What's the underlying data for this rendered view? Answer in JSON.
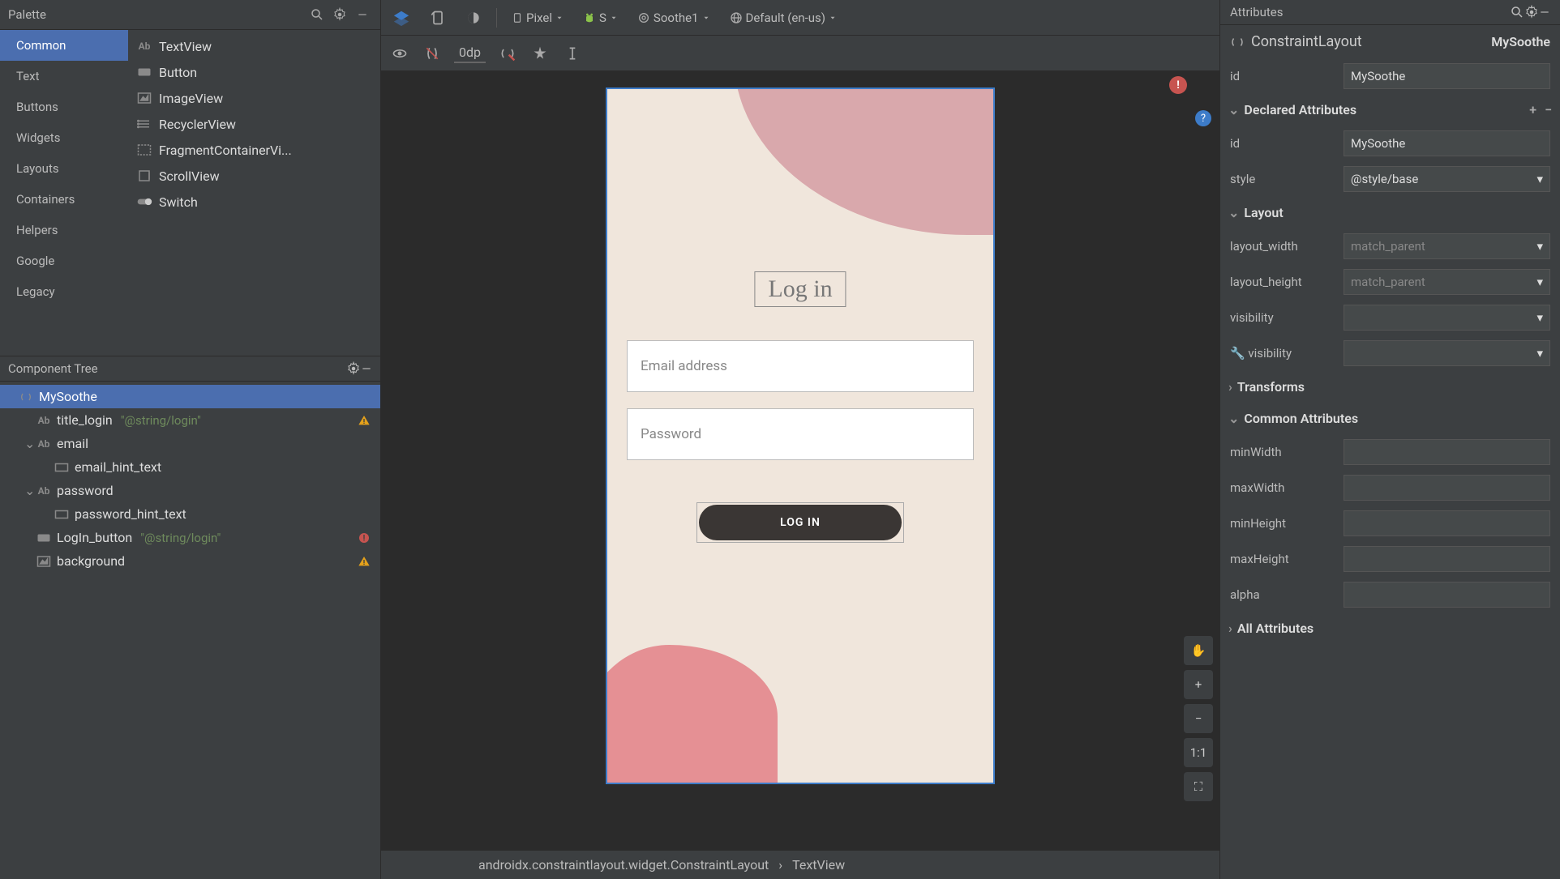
{
  "palette": {
    "title": "Palette",
    "categories": [
      "Common",
      "Text",
      "Buttons",
      "Widgets",
      "Layouts",
      "Containers",
      "Helpers",
      "Google",
      "Legacy"
    ],
    "selected_category": "Common",
    "items": [
      {
        "icon": "text-ab",
        "label": "TextView"
      },
      {
        "icon": "button",
        "label": "Button"
      },
      {
        "icon": "image",
        "label": "ImageView"
      },
      {
        "icon": "recycler",
        "label": "RecyclerView"
      },
      {
        "icon": "fragment",
        "label": "FragmentContainerVi..."
      },
      {
        "icon": "scroll",
        "label": "ScrollView"
      },
      {
        "icon": "switch",
        "label": "Switch"
      }
    ]
  },
  "component_tree": {
    "title": "Component Tree",
    "nodes": [
      {
        "depth": 0,
        "icon": "constraint",
        "label": "MySoothe",
        "selected": true
      },
      {
        "depth": 1,
        "icon": "text-ab",
        "label": "title_login",
        "hint": "\"@string/login\"",
        "warn": "warning"
      },
      {
        "depth": 1,
        "icon": "text-ab",
        "label": "email",
        "chev": "open"
      },
      {
        "depth": 2,
        "icon": "rect",
        "label": "email_hint_text"
      },
      {
        "depth": 1,
        "icon": "text-ab",
        "label": "password",
        "chev": "open"
      },
      {
        "depth": 2,
        "icon": "rect",
        "label": "password_hint_text"
      },
      {
        "depth": 1,
        "icon": "button",
        "label": "LogIn_button",
        "hint": "\"@string/login\"",
        "warn": "error"
      },
      {
        "depth": 1,
        "icon": "image",
        "label": "background",
        "warn": "warning"
      }
    ]
  },
  "top_toolbar": {
    "device": "Pixel",
    "api": "S",
    "theme": "Soothe1",
    "locale": "Default (en-us)"
  },
  "second_toolbar": {
    "dp": "0dp"
  },
  "preview": {
    "title": "Log in",
    "email_hint": "Email address",
    "password_hint": "Password",
    "button_label": "LOG IN"
  },
  "breadcrumb": {
    "path1": "androidx.constraintlayout.widget.ConstraintLayout",
    "path2": "TextView"
  },
  "attributes": {
    "title": "Attributes",
    "class_name": "ConstraintLayout",
    "instance_name": "MySoothe",
    "id_value": "MySoothe",
    "sections": {
      "declared": {
        "title": "Declared Attributes",
        "rows": [
          {
            "label": "id",
            "value": "MySoothe",
            "type": "text"
          },
          {
            "label": "style",
            "value": "@style/base",
            "type": "select"
          }
        ]
      },
      "layout": {
        "title": "Layout",
        "rows": [
          {
            "label": "layout_width",
            "value": "match_parent",
            "type": "select",
            "faded": true
          },
          {
            "label": "layout_height",
            "value": "match_parent",
            "type": "select",
            "faded": true
          },
          {
            "label": "visibility",
            "value": "",
            "type": "select"
          },
          {
            "label": "visibility",
            "value": "",
            "type": "select",
            "tools": true
          }
        ]
      },
      "transforms": {
        "title": "Transforms"
      },
      "common": {
        "title": "Common Attributes",
        "rows": [
          {
            "label": "minWidth",
            "value": "",
            "type": "text"
          },
          {
            "label": "maxWidth",
            "value": "",
            "type": "text"
          },
          {
            "label": "minHeight",
            "value": "",
            "type": "text"
          },
          {
            "label": "maxHeight",
            "value": "",
            "type": "text"
          },
          {
            "label": "alpha",
            "value": "",
            "type": "text"
          }
        ]
      },
      "all": {
        "title": "All Attributes"
      }
    }
  }
}
